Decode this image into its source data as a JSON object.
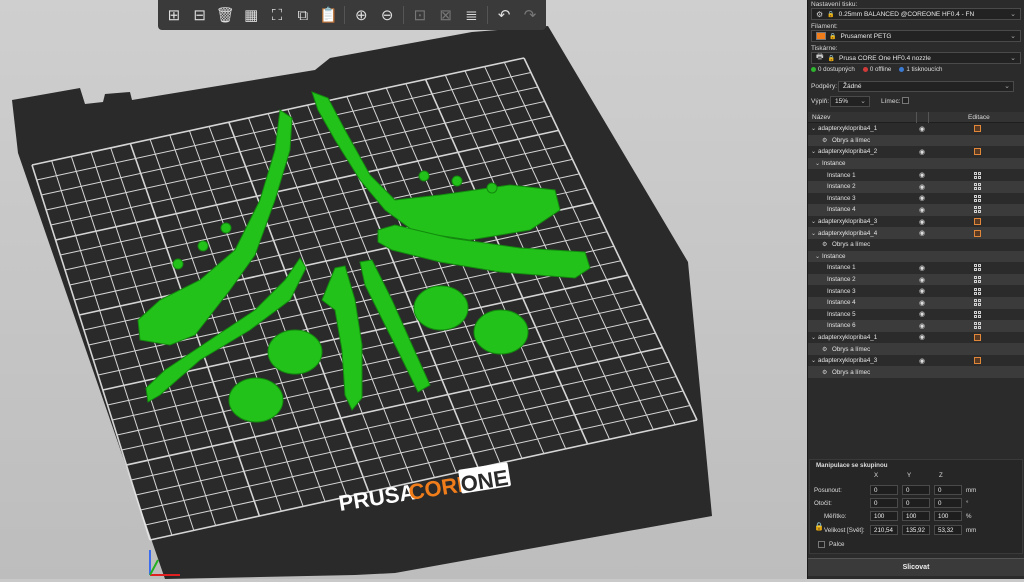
{
  "toolbar": {
    "items": [
      "add-object",
      "delete",
      "delete-all",
      "arrange",
      "arrange-selection",
      "copy",
      "paste",
      "add-instance",
      "remove-instance",
      "split-objects",
      "split-parts",
      "layers-editing",
      "undo",
      "redo"
    ]
  },
  "bed": {
    "brand_prusa": "PRUSA",
    "brand_core": "CORE",
    "brand_one": "ONE"
  },
  "panel": {
    "print_settings_label": "Nastavení tisku:",
    "print_settings_value": "0.25mm BALANCED @COREONE HF0.4 - FN",
    "filament_label": "Filament:",
    "filament_value": "Prusament PETG",
    "filament_color": "#f07d1a",
    "printer_label": "Tiskárne:",
    "printer_value": "Prusa CORE One HF0.4 nozzle",
    "status_available": "0 dostupných",
    "status_offline": "0 offline",
    "status_printing": "1 tisknoucích",
    "supports_label": "Podpěry:",
    "supports_value": "Žádné",
    "infill_label": "Výplň:",
    "infill_value": "15%",
    "brim_label": "Límec:"
  },
  "list": {
    "col_name": "Název",
    "col_edit": "Editace",
    "rows": [
      {
        "type": "object",
        "text": "adapterxyklopriba4_1",
        "eye": true,
        "edit": "edit"
      },
      {
        "type": "child",
        "text": "Obrys a límec"
      },
      {
        "type": "object",
        "text": "adapterxyklopriba4_2",
        "eye": true,
        "edit": "edit"
      },
      {
        "type": "group",
        "text": "Instance"
      },
      {
        "type": "instance",
        "text": "Instance 1",
        "eye": true,
        "edit": "grid"
      },
      {
        "type": "instance",
        "text": "Instance 2",
        "eye": true,
        "edit": "grid"
      },
      {
        "type": "instance",
        "text": "Instance 3",
        "eye": true,
        "edit": "grid"
      },
      {
        "type": "instance",
        "text": "Instance 4",
        "eye": true,
        "edit": "grid"
      },
      {
        "type": "object",
        "text": "adapterxyklopriba4_3",
        "eye": true,
        "edit": "edit"
      },
      {
        "type": "object",
        "text": "adapterxyklopriba4_4",
        "eye": true,
        "edit": "edit"
      },
      {
        "type": "child",
        "text": "Obrys a límec"
      },
      {
        "type": "group",
        "text": "Instance"
      },
      {
        "type": "instance",
        "text": "Instance 1",
        "eye": true,
        "edit": "grid"
      },
      {
        "type": "instance",
        "text": "Instance 2",
        "eye": true,
        "edit": "grid"
      },
      {
        "type": "instance",
        "text": "Instance 3",
        "eye": true,
        "edit": "grid"
      },
      {
        "type": "instance",
        "text": "Instance 4",
        "eye": true,
        "edit": "grid"
      },
      {
        "type": "instance",
        "text": "Instance 5",
        "eye": true,
        "edit": "grid"
      },
      {
        "type": "instance",
        "text": "Instance 6",
        "eye": true,
        "edit": "grid"
      },
      {
        "type": "object",
        "text": "adapterxyklopriba4_1",
        "eye": true,
        "edit": "edit"
      },
      {
        "type": "child",
        "text": "Obrys a límec"
      },
      {
        "type": "object",
        "text": "adapterxyklopriba4_3",
        "eye": true,
        "edit": "edit"
      },
      {
        "type": "child",
        "text": "Obrys a límec"
      }
    ]
  },
  "manip": {
    "title": "Manipulace se skupinou",
    "axis_x": "X",
    "axis_y": "Y",
    "axis_z": "Z",
    "pos_label": "Posunout:",
    "pos": [
      "0",
      "0",
      "0"
    ],
    "pos_unit": "mm",
    "rot_label": "Otočit:",
    "rot": [
      "0",
      "0",
      "0"
    ],
    "rot_unit": "°",
    "scale_label": "Měřítko:",
    "scale": [
      "100",
      "100",
      "100"
    ],
    "scale_unit": "%",
    "size_label": "Velikost [Svět]:",
    "size": [
      "210,54",
      "135,92",
      "53,32"
    ],
    "size_unit": "mm",
    "inches_label": "Palce"
  },
  "slice_button": "Slicovat"
}
